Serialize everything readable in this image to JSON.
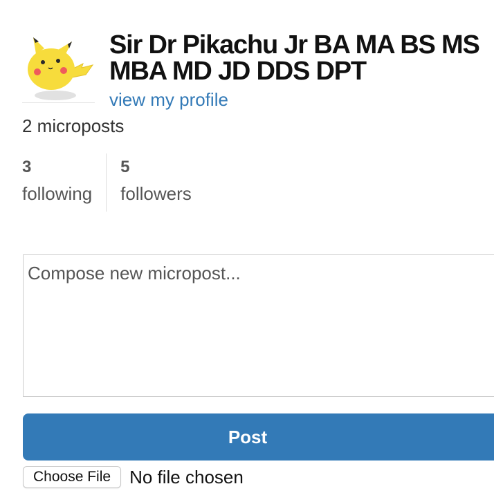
{
  "user": {
    "name": "Sir Dr Pikachu Jr BA MA BS MS MBA MD JD DDS DPT",
    "profile_link": "view my profile",
    "microposts": "2 microposts",
    "avatar_icon": "pikachu-avatar-icon"
  },
  "stats": {
    "following": {
      "count": "3",
      "label": "following"
    },
    "followers": {
      "count": "5",
      "label": "followers"
    }
  },
  "compose": {
    "placeholder": "Compose new micropost...",
    "value": "",
    "post_label": "Post",
    "choose_file_label": "Choose File",
    "file_status": "No file chosen"
  },
  "colors": {
    "accent": "#337ab7",
    "avatar_yellow": "#f7dc3c",
    "avatar_cheek": "#ef5b5b"
  }
}
